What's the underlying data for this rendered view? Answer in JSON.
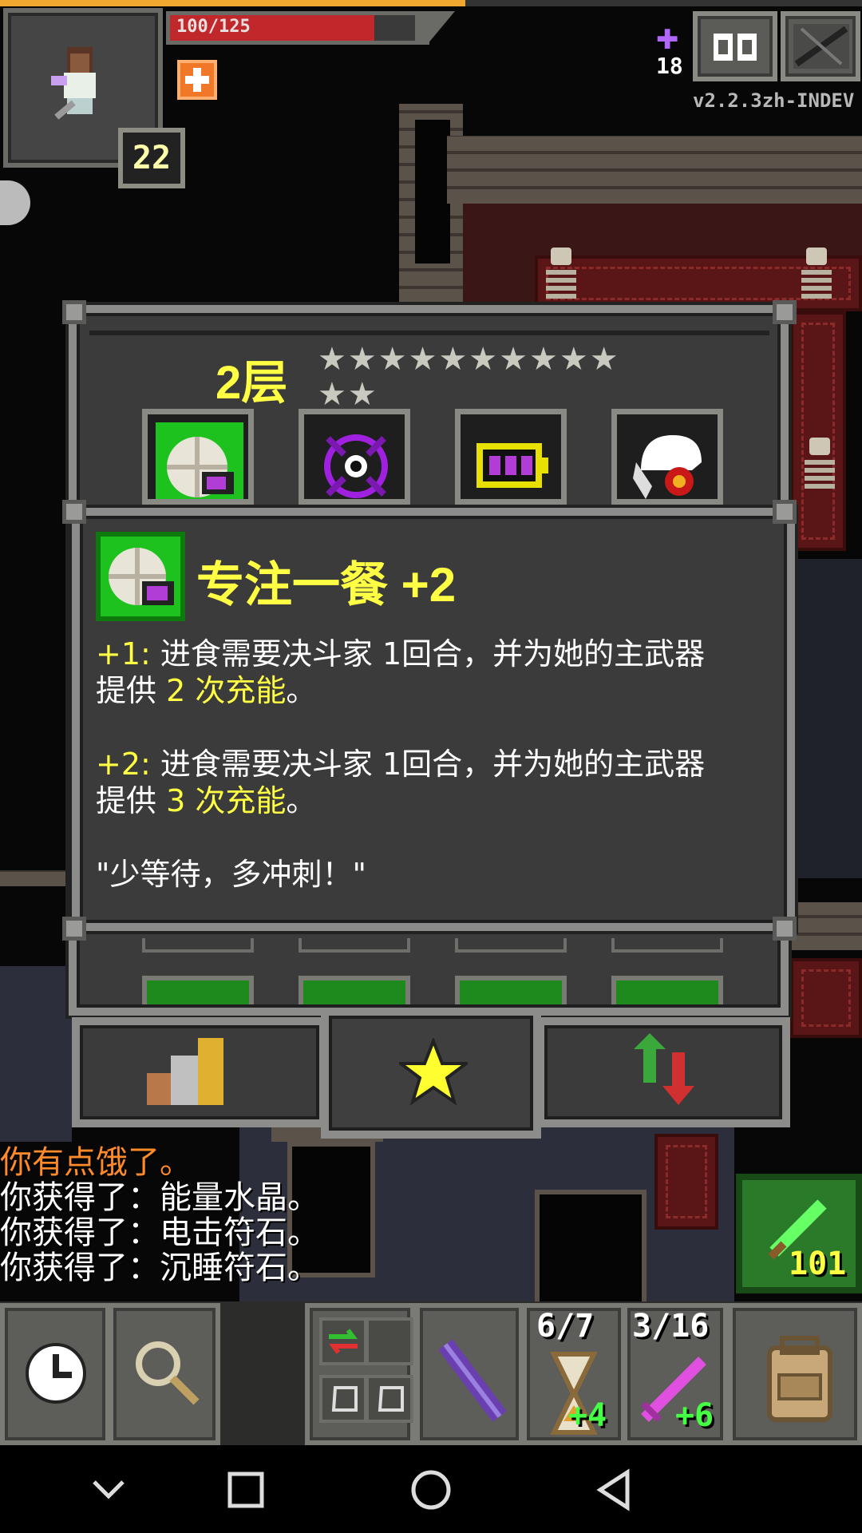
{
  "status": {
    "hp_text": "100/125",
    "hp_fraction": 0.8,
    "xp_fraction": 0.54,
    "level": "22",
    "depth": "18",
    "version": "v2.2.3zh-INDEV"
  },
  "talent_window": {
    "tier_label": "2层",
    "stars": "★★★★★★★★★★ ★★",
    "talent_icons": [
      "focused-meal-icon",
      "void-eye-icon",
      "battery-icon",
      "skull-eye-icon"
    ]
  },
  "detail": {
    "title": "专注一餐 +2",
    "line1_prefix": "+1:",
    "line1_text": " 进食需要决斗家 1回合，并为她的主武器",
    "line1_cont_a": "提供 ",
    "line1_hl": "2 次充能",
    "line1_end": "。",
    "line2_prefix": "+2:",
    "line2_text": " 进食需要决斗家 1回合，并为她的主武器",
    "line2_cont_a": "提供 ",
    "line2_hl": "3 次充能",
    "line2_end": "。",
    "quote": "\"少等待，多冲刺！\""
  },
  "log": {
    "line1": "你有点饿了。",
    "line2": "你获得了：能量水晶。",
    "line3": "你获得了：电击符石。",
    "line4": "你获得了：沉睡符石。"
  },
  "quick_weapon": {
    "count": "101"
  },
  "toolbar": {
    "slot_a_top": "6/7",
    "slot_a_bottom": "+4",
    "slot_b_top": "3/16",
    "slot_b_bottom": "+6"
  },
  "colors": {
    "accent": "#ffff44",
    "hp": "#c0282c",
    "frame": "#8c8c8a"
  }
}
